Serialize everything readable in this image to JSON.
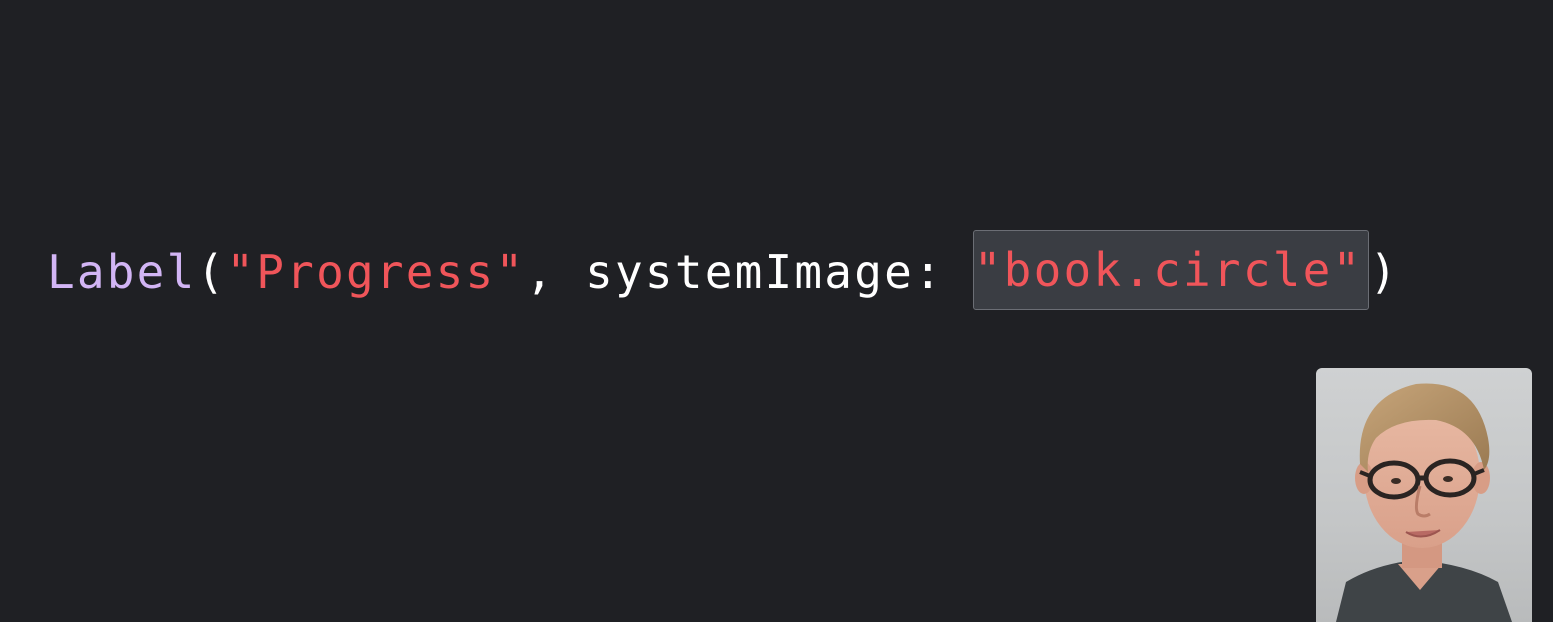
{
  "code": {
    "type_name": "Label",
    "open_paren": "(",
    "title_string": "\"Progress\"",
    "separator": ", ",
    "param_label": "systemImage: ",
    "image_string": "\"book.circle\"",
    "close_paren": ")"
  },
  "colors": {
    "background": "#1f2024",
    "type": "#d2b5f5",
    "string": "#f0555a",
    "plain": "#ffffff",
    "highlight_bg": "#3a3d43"
  },
  "presenter": {
    "icon": "presenter-video-thumbnail"
  }
}
